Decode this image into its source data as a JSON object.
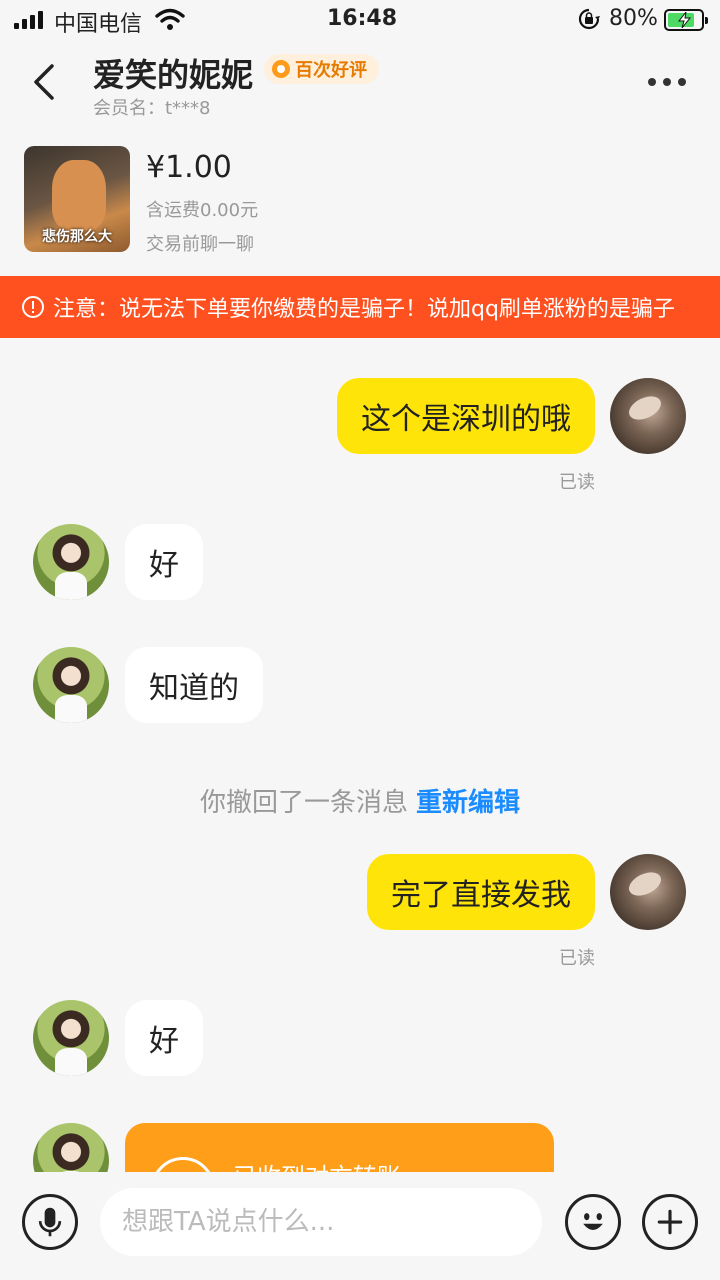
{
  "status_bar": {
    "carrier": "中国电信",
    "time": "16:48",
    "battery_percent": "80%",
    "battery_level": 0.8,
    "icons": [
      "signal-icon",
      "wifi-icon",
      "rotation-lock-icon",
      "battery-charging-icon"
    ]
  },
  "header": {
    "title": "爱笑的妮妮",
    "badge": "百次好评",
    "member_label": "会员名：t***8"
  },
  "product": {
    "image_caption": "悲伤那么大",
    "price": "¥1.00",
    "shipping": "含运费0.00元",
    "chat_note": "交易前聊一聊"
  },
  "warning": {
    "text": "注意：说无法下单要你缴费的是骗子！说加qq刷单涨粉的是骗子"
  },
  "messages": [
    {
      "from": "me",
      "text": "这个是深圳的哦",
      "status": "已读"
    },
    {
      "from": "them",
      "text": "好"
    },
    {
      "from": "them",
      "text": "知道的"
    },
    {
      "type": "system",
      "text": "你撤回了一条消息",
      "action": "重新编辑"
    },
    {
      "from": "me",
      "text": "完了直接发我",
      "status": "已读"
    },
    {
      "from": "them",
      "text": "好"
    },
    {
      "from": "them",
      "type": "transfer",
      "text": "已收到对方转账"
    }
  ],
  "input": {
    "placeholder": "想跟TA说点什么..."
  },
  "colors": {
    "my_bubble": "#ffe40a",
    "warning_bg": "#ff5020",
    "transfer_card": "#ff9e18",
    "link": "#1a8cff"
  }
}
